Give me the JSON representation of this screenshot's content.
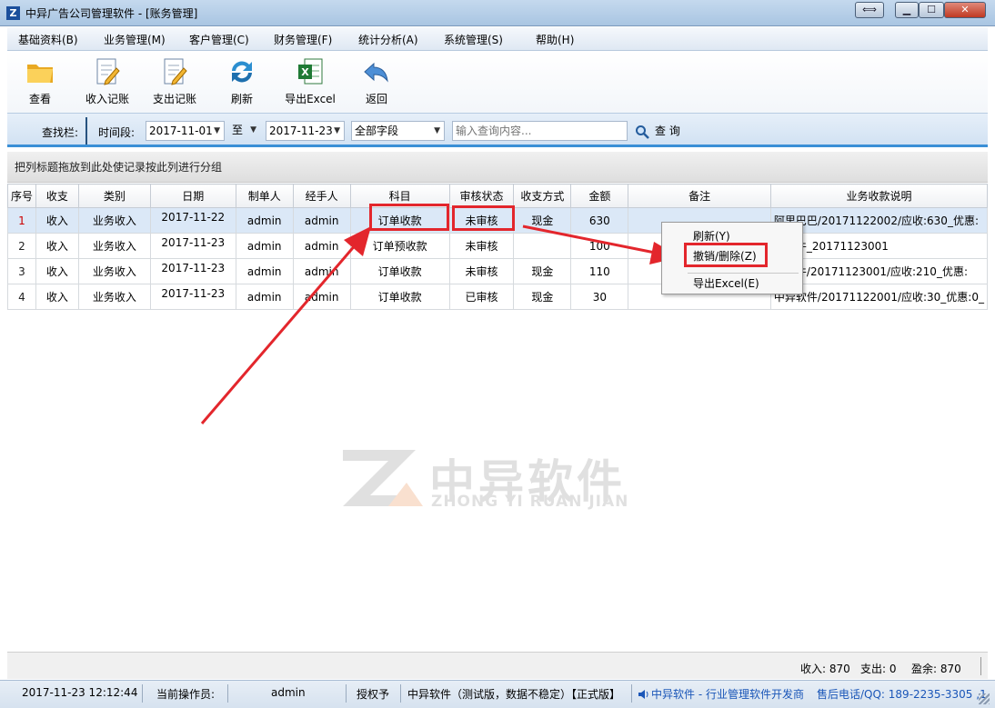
{
  "window": {
    "title": "中异广告公司管理软件 - [账务管理]",
    "app_icon_glyph": "Z",
    "controls": {
      "restore_label": "⟺",
      "minimize_label": "▁",
      "maximize_label": "☐",
      "close_label": "✕"
    }
  },
  "menu": {
    "items": [
      "基础资料(B)",
      "业务管理(M)",
      "客户管理(C)",
      "财务管理(F)",
      "统计分析(A)",
      "系统管理(S)",
      "帮助(H)"
    ]
  },
  "toolbar": {
    "items": [
      {
        "label": "查看",
        "icon": "folder-icon"
      },
      {
        "label": "收入记账",
        "icon": "edit-doc-icon"
      },
      {
        "label": "支出记账",
        "icon": "edit-doc-icon"
      },
      {
        "label": "刷新",
        "icon": "refresh-icon"
      },
      {
        "label": "导出Excel",
        "icon": "excel-icon"
      },
      {
        "label": "返回",
        "icon": "back-arrow-icon"
      }
    ]
  },
  "search": {
    "bar_label": "查找栏:",
    "period_label": "时间段:",
    "start_date": "2017-11-01",
    "to_label": "至",
    "end_date": "2017-11-23",
    "field_select": "全部字段",
    "placeholder": "输入查询内容...",
    "query_label": "查 询"
  },
  "group_hint": "把列标题拖放到此处使记录按此列进行分组",
  "table": {
    "columns": [
      "序号",
      "收支",
      "类别",
      "日期",
      "制单人",
      "经手人",
      "科目",
      "审核状态",
      "收支方式",
      "金额",
      "备注",
      "业务收款说明"
    ],
    "rows": [
      {
        "seq": "1",
        "type": "收入",
        "category": "业务收入",
        "date": "2017-11-22",
        "maker": "admin",
        "handler": "admin",
        "subject": "订单收款",
        "audit": "未审核",
        "method": "现金",
        "amount": "630",
        "note": "",
        "desc": "阿里巴巴/20171122002/应收:630_优惠:"
      },
      {
        "seq": "2",
        "type": "收入",
        "category": "业务收入",
        "date": "2017-11-23",
        "maker": "admin",
        "handler": "admin",
        "subject": "订单预收款",
        "audit": "未审核",
        "method": "",
        "amount": "100",
        "note": "",
        "desc": "异软件_20171123001"
      },
      {
        "seq": "3",
        "type": "收入",
        "category": "业务收入",
        "date": "2017-11-23",
        "maker": "admin",
        "handler": "admin",
        "subject": "订单收款",
        "audit": "未审核",
        "method": "现金",
        "amount": "110",
        "note": "",
        "desc": "异软件/20171123001/应收:210_优惠:"
      },
      {
        "seq": "4",
        "type": "收入",
        "category": "业务收入",
        "date": "2017-11-23",
        "maker": "admin",
        "handler": "admin",
        "subject": "订单收款",
        "audit": "已审核",
        "method": "现金",
        "amount": "30",
        "note": "",
        "desc": "中异软件/20171122001/应收:30_优惠:0_"
      }
    ]
  },
  "context_menu": {
    "items": [
      "刷新(Y)",
      "撤销/删除(Z)",
      "导出Excel(E)"
    ]
  },
  "watermark": {
    "cn": "中异软件",
    "en": "ZHONG YI RUAN JIAN"
  },
  "totals": {
    "income": "收入: 870",
    "expense": "支出: 0",
    "balance": "盈余: 870"
  },
  "status": {
    "datetime": "2017-11-23 12:12:44",
    "operator_label": "当前操作员:",
    "operator": "admin",
    "license": "授权予",
    "edition": "中异软件（测试版，数据不稳定）【正式版】",
    "vendor": "中异软件 - 行业管理软件开发商",
    "support": "售后电话/QQ: 189-2235-3305 ,1"
  },
  "colors": {
    "highlight_red": "#e3262c",
    "accent_blue": "#3a8fd6",
    "selected_row": "#dbe8f7"
  }
}
